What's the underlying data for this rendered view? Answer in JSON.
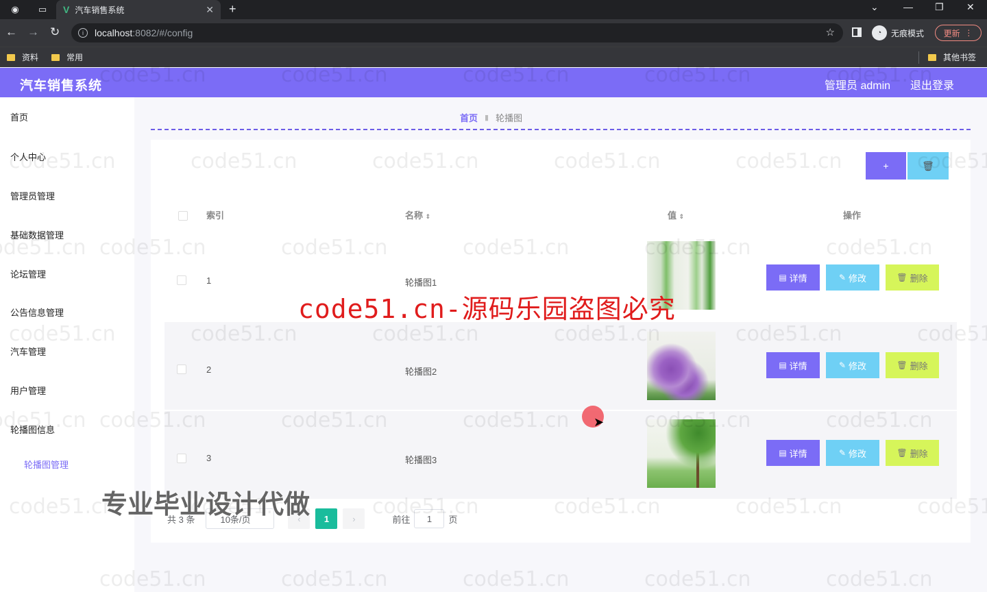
{
  "browser": {
    "tab_title": "汽车销售系统",
    "url_host": "localhost",
    "url_path": ":8082/#/config",
    "incognito_label": "无痕模式",
    "update_label": "更新",
    "bookmarks": [
      "资料",
      "常用"
    ],
    "other_bookmarks": "其他书签"
  },
  "header": {
    "title": "汽车销售系统",
    "admin_label": "管理员 admin",
    "logout_label": "退出登录"
  },
  "sidebar": {
    "items": [
      {
        "label": "首页"
      },
      {
        "label": "个人中心"
      },
      {
        "label": "管理员管理"
      },
      {
        "label": "基础数据管理"
      },
      {
        "label": "论坛管理"
      },
      {
        "label": "公告信息管理"
      },
      {
        "label": "汽车管理"
      },
      {
        "label": "用户管理"
      },
      {
        "label": "轮播图信息"
      }
    ],
    "sub_item": "轮播图管理"
  },
  "breadcrumb": {
    "home": "首页",
    "current": "轮播图"
  },
  "toolbar": {
    "add_label": "+",
    "delete_label": "🗑"
  },
  "table": {
    "headers": {
      "index": "索引",
      "name": "名称",
      "value": "值",
      "actions": "操作"
    },
    "rows": [
      {
        "index": "1",
        "name": "轮播图1",
        "image": "grass-green"
      },
      {
        "index": "2",
        "name": "轮播图2",
        "image": "purple-flowers"
      },
      {
        "index": "3",
        "name": "轮播图3",
        "image": "meadow-tree"
      }
    ],
    "actions": {
      "detail": "详情",
      "edit": "修改",
      "delete": "删除"
    }
  },
  "pagination": {
    "total": "共 3 条",
    "page_size": "10条/页",
    "current_page": "1",
    "goto_label": "前往",
    "goto_value": "1",
    "page_suffix": "页"
  },
  "overlays": {
    "watermark": "code51.cn",
    "red_watermark": "code51.cn-源码乐园盗图必究",
    "promo": "专业毕业设计代做"
  },
  "colors": {
    "accent": "#7b6cf6",
    "edit": "#6fd0f5",
    "delete": "#d6f55a",
    "page_active": "#1abc9c"
  }
}
